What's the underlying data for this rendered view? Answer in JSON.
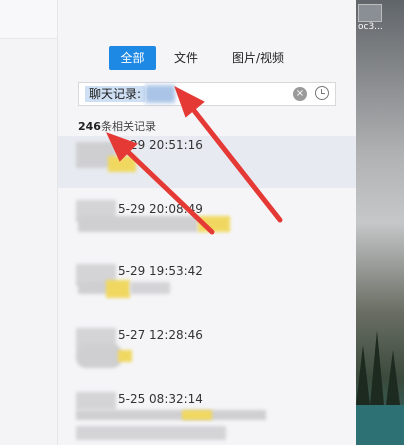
{
  "tabs": [
    {
      "label": "全部",
      "active": true
    },
    {
      "label": "文件",
      "active": false
    },
    {
      "label": "图片/视频",
      "active": false
    }
  ],
  "search": {
    "value": "聊天记录:",
    "clear_icon": "clear-icon",
    "history_icon": "history-icon"
  },
  "result_count": {
    "number": "246",
    "suffix": "条相关记录"
  },
  "results": [
    {
      "time": "5-29 20:51:16",
      "highlighted": true
    },
    {
      "time": "5-29 20:08:49",
      "highlighted": false
    },
    {
      "time": "5-29 19:53:42",
      "highlighted": false
    },
    {
      "time": "5-27 12:28:46",
      "highlighted": false
    },
    {
      "time": "5-25 08:32:14",
      "highlighted": false
    }
  ],
  "desktop": {
    "icon_label": "oc3..."
  },
  "colors": {
    "accent": "#1e88e5",
    "annotation_arrow": "#e53935",
    "highlight": "#f3d34a"
  }
}
